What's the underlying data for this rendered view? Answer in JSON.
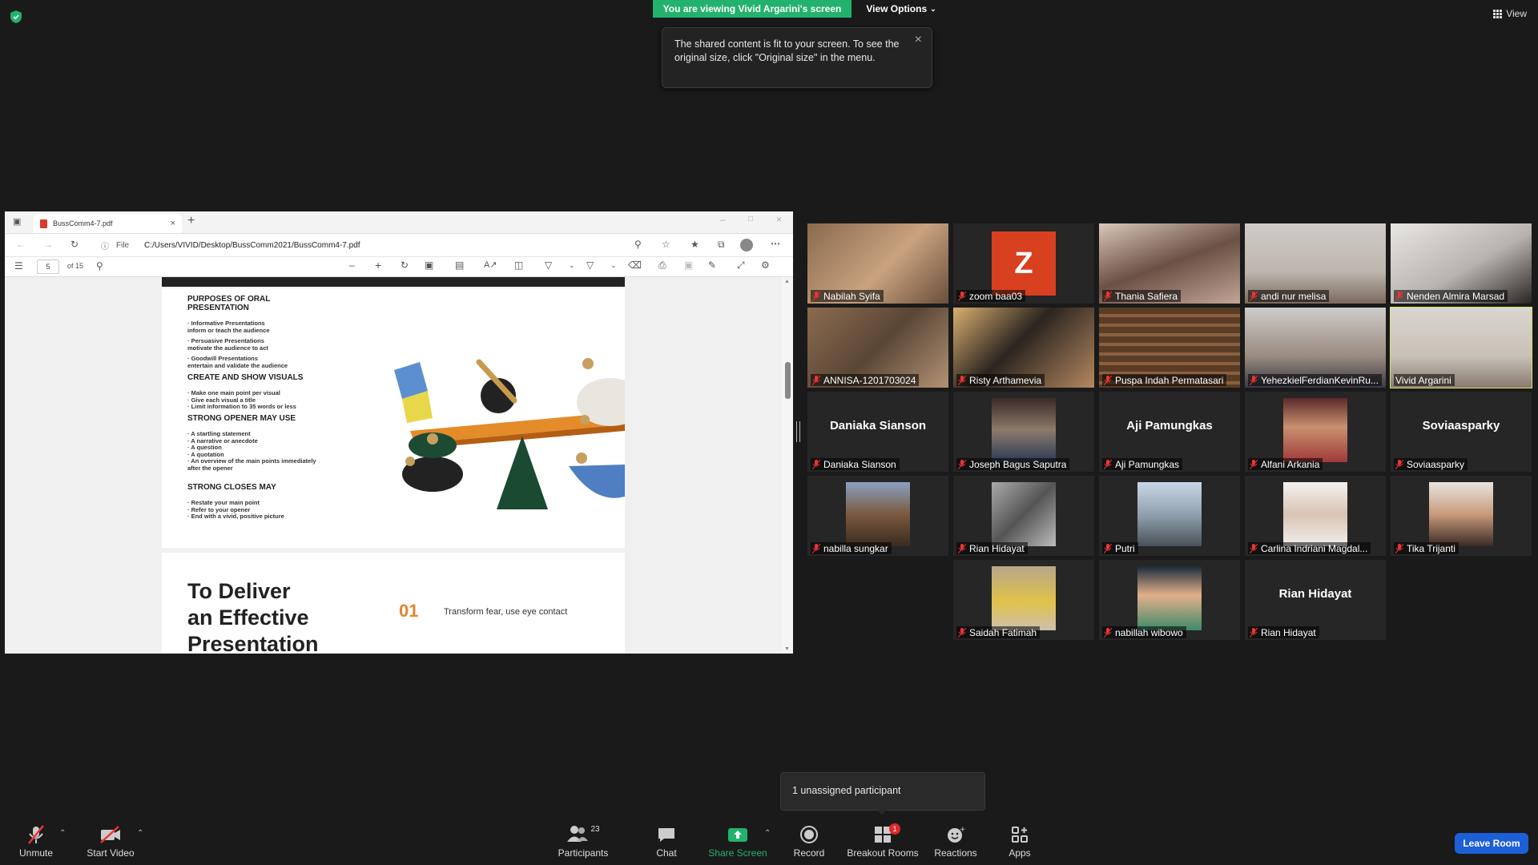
{
  "top": {
    "banner": "You are viewing Vivid Argarini's screen",
    "view_options": "View Options",
    "view_label": "View",
    "tooltip": "The shared content is fit to your screen. To see the original size, click \"Original size\" in the menu."
  },
  "browser": {
    "tab_title": "BussComm4-7.pdf",
    "file_label": "File",
    "url": "C:/Users/VIVID/Desktop/BussComm2021/BussComm4-7.pdf",
    "page_current": "5",
    "page_total": "of 15"
  },
  "slide1": {
    "h1": "PURPOSES OF ORAL PRESENTATION",
    "p1a": "· Informative Presentations",
    "p1b": "inform or teach the audience",
    "p1c": "· Persuasive Presentations",
    "p1d": "motivate the audience to act",
    "p1e": "· Goodwill Presentations",
    "p1f": "entertain and validate the audience",
    "h2": "CREATE AND SHOW VISUALS",
    "p2a": "· Make one main point per visual",
    "p2b": "· Give each visual a title",
    "p2c": "· Limit information to 35 words or less",
    "h3": "STRONG OPENER MAY USE",
    "p3a": "· A startling statement",
    "p3b": "· A narrative or anecdote",
    "p3c": "· A question",
    "p3d": "· A quotation",
    "p3e": "· An overview of the main points immediately",
    "p3f": "after the opener",
    "h4": "STRONG CLOSES MAY",
    "p4a": "· Restate your main point",
    "p4b": "· Refer to your opener",
    "p4c": "· End with a vivid, positive picture"
  },
  "slide2": {
    "title_1": "To Deliver",
    "title_2": "an Effective",
    "title_3": "Presentation",
    "num": "01",
    "item": "Transform fear, use eye contact"
  },
  "participants": [
    {
      "name": "Nabilah Syifa"
    },
    {
      "name": "zoom baa03",
      "initial": "Z"
    },
    {
      "name": "Thania Safiera"
    },
    {
      "name": "andi nur melisa"
    },
    {
      "name": "Nenden Almira Marsad"
    },
    {
      "name": "ANNISA-1201703024"
    },
    {
      "name": "Risty Arthamevia"
    },
    {
      "name": "Puspa Indah Permatasari"
    },
    {
      "name": "YehezkielFerdianKevinRu..."
    },
    {
      "name": "Vivid Argarini"
    },
    {
      "name": "Daniaka Sianson",
      "big": "Daniaka Sianson"
    },
    {
      "name": "Joseph Bagus Saputra"
    },
    {
      "name": "Aji Pamungkas",
      "big": "Aji Pamungkas"
    },
    {
      "name": "Alfani Arkania"
    },
    {
      "name": "Soviaasparky",
      "big": "Soviaasparky"
    },
    {
      "name": "nabilla sungkar"
    },
    {
      "name": "Rian Hidayat"
    },
    {
      "name": "Putri"
    },
    {
      "name": "Carlina Indriani Magdal..."
    },
    {
      "name": "Tika Trijanti"
    },
    {
      "name": "Saidah Fatimah"
    },
    {
      "name": "nabillah wibowo"
    },
    {
      "name": "Rian Hidayat",
      "big": "Rian Hidayat"
    }
  ],
  "unassigned": "1 unassigned participant",
  "toolbar": {
    "unmute": "Unmute",
    "start_video": "Start Video",
    "participants": "Participants",
    "participants_count": "23",
    "chat": "Chat",
    "share_screen": "Share Screen",
    "record": "Record",
    "breakout_rooms": "Breakout Rooms",
    "breakout_badge": "1",
    "reactions": "Reactions",
    "apps": "Apps",
    "leave_room": "Leave Room"
  },
  "colors": {
    "banner_green": "#23b26d",
    "share_green": "#23b26d",
    "active_speaker": "#d8e26b",
    "leave_blue": "#1d5fd6",
    "badge_red": "#e02828",
    "zoom_avatar": "#d8401f",
    "slide_accent": "#e0872a"
  }
}
